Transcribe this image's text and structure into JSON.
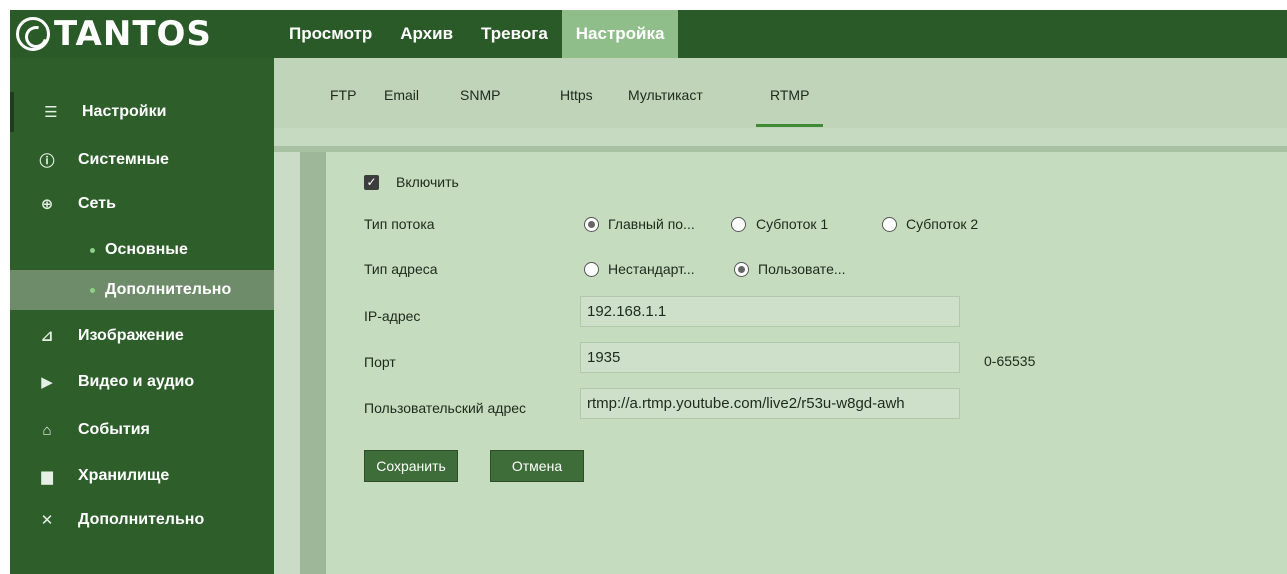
{
  "app": {
    "logo_text": "TANTOS"
  },
  "topnav": [
    {
      "label": "Просмотр"
    },
    {
      "label": "Архив"
    },
    {
      "label": "Тревога"
    },
    {
      "label": "Настройка",
      "active": true
    }
  ],
  "sidebar": [
    {
      "label": "Настройки",
      "icon": "list-icon"
    },
    {
      "label": "Системные",
      "icon": "info-icon"
    },
    {
      "label": "Сеть",
      "icon": "network-icon"
    },
    {
      "label": "Основные",
      "sub": true
    },
    {
      "label": "Дополнительно",
      "sub": true,
      "selected": true
    },
    {
      "label": "Изображение",
      "icon": "image-icon"
    },
    {
      "label": "Видео и аудио",
      "icon": "video-icon"
    },
    {
      "label": "События",
      "icon": "events-icon"
    },
    {
      "label": "Хранилище",
      "icon": "storage-icon"
    },
    {
      "label": "Дополнительно",
      "icon": "tools-icon"
    }
  ],
  "subtabs": [
    {
      "label": "FTP"
    },
    {
      "label": "Email"
    },
    {
      "label": "SNMP"
    },
    {
      "label": "Https"
    },
    {
      "label": "Мультикаст"
    },
    {
      "label": "RTMP",
      "active": true
    }
  ],
  "form": {
    "enable_label": "Включить",
    "enable_checked": true,
    "stream_type": {
      "label": "Тип потока",
      "options": [
        "Главный по...",
        "Субпоток 1",
        "Субпоток 2"
      ],
      "selected": 0
    },
    "address_type": {
      "label": "Тип адреса",
      "options": [
        "Нестандарт...",
        "Пользовате..."
      ],
      "selected": 1
    },
    "ip": {
      "label": "IP-адрес",
      "value": "192.168.1.1"
    },
    "port": {
      "label": "Порт",
      "value": "1935",
      "range": "0-65535"
    },
    "custom_address": {
      "label": "Пользовательский адрес",
      "value": "rtmp://a.rtmp.youtube.com/live2/r53u-w8gd-awh"
    },
    "save_label": "Сохранить",
    "cancel_label": "Отмена"
  },
  "colors": {
    "header": "#2a5a27",
    "accent": "#3e8a37",
    "panel": "#c6dcbf"
  }
}
